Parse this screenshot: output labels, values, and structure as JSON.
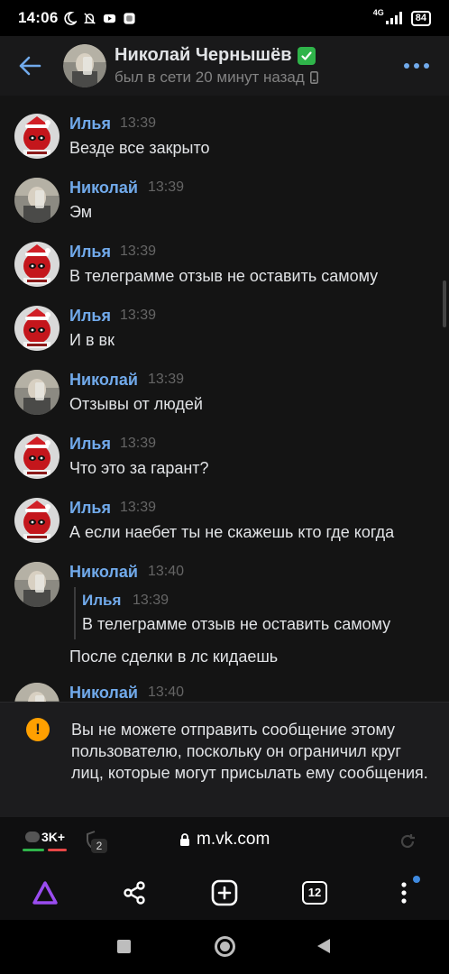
{
  "status_bar": {
    "time": "14:06",
    "network": "4G",
    "battery": "84"
  },
  "header": {
    "name": "Николай Чернышёв",
    "status": "был в сети 20 минут назад"
  },
  "messages": [
    {
      "author": "Илья",
      "time": "13:39",
      "text": "Везде все закрыто",
      "avatar": "ilya"
    },
    {
      "author": "Николай",
      "time": "13:39",
      "text": "Эм",
      "avatar": "nikolay"
    },
    {
      "author": "Илья",
      "time": "13:39",
      "text": "В телеграмме отзыв не оставить самому",
      "avatar": "ilya"
    },
    {
      "author": "Илья",
      "time": "13:39",
      "text": "И в вк",
      "avatar": "ilya"
    },
    {
      "author": "Николай",
      "time": "13:39",
      "text": "Отзывы от людей",
      "avatar": "nikolay"
    },
    {
      "author": "Илья",
      "time": "13:39",
      "text": "Что это за гарант?",
      "avatar": "ilya"
    },
    {
      "author": "Илья",
      "time": "13:39",
      "text": "А если наебет ты не скажешь кто где когда",
      "avatar": "ilya"
    },
    {
      "author": "Николай",
      "time": "13:40",
      "text": "После сделки в лс кидаешь",
      "avatar": "nikolay",
      "reply": {
        "author": "Илья",
        "time": "13:39",
        "text": "В телеграмме отзыв не оставить самому"
      }
    },
    {
      "author": "Николай",
      "time": "13:40",
      "text": "",
      "avatar": "nikolay"
    }
  ],
  "notice": {
    "text": "Вы не можете отправить сообщение этому пользователю, поскольку он ограничил круг лиц, которые могут присылать ему сообщения."
  },
  "browser": {
    "comments_count": "3K+",
    "shield_count": "2",
    "url": "m.vk.com",
    "tabs_count": "12"
  },
  "colors": {
    "accent": "#71aaeb",
    "warning": "#ffa000",
    "verified": "#2fb44a",
    "alice": "#9a4cf0"
  }
}
